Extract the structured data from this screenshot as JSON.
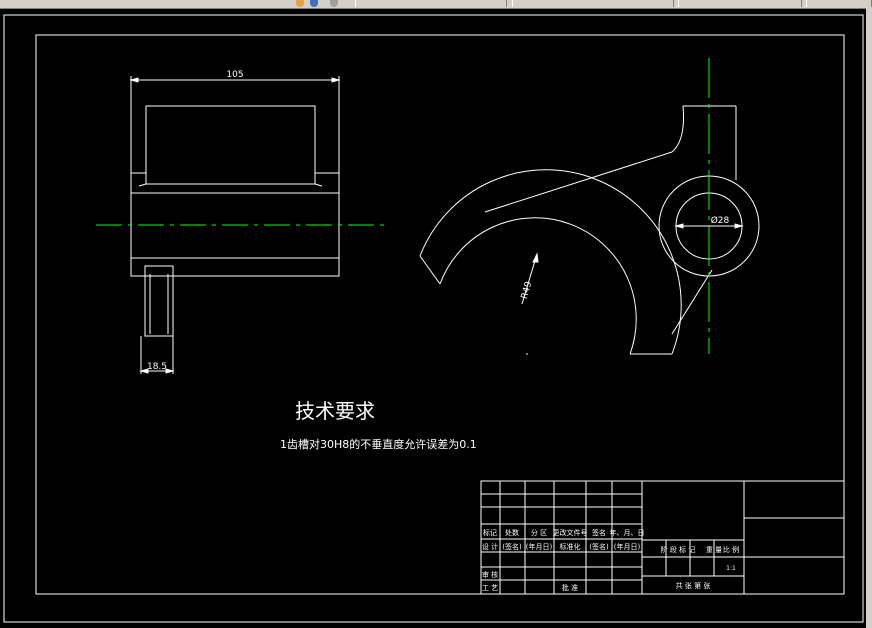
{
  "toolbar": {
    "tabs": [
      "",
      "",
      "",
      "",
      "",
      ""
    ]
  },
  "drawing": {
    "dimensions": {
      "width_top": "105",
      "width_bottom": "18.5",
      "radius": "R49",
      "diameter": "Ø28"
    },
    "tech_requirements": {
      "title": "技术要求",
      "line1": "1齿槽对30H8的不垂直度允许误差为0.1"
    },
    "title_block": {
      "row_labels": [
        "标记",
        "处数",
        "分 区",
        "更改文件号",
        "签名",
        "年、月、日"
      ],
      "design_row": [
        "设 计",
        "(签名)",
        "(年月日)",
        "标准化",
        "(签名)",
        "(年月日)"
      ],
      "stage_headers": [
        "阶 段 标 记",
        "重 量",
        "比 例"
      ],
      "scale_value": "1:1",
      "review_label": "审 核",
      "process_label": "工 艺",
      "approve_label": "批 准",
      "sheets_text": "共    张    第    张"
    }
  }
}
